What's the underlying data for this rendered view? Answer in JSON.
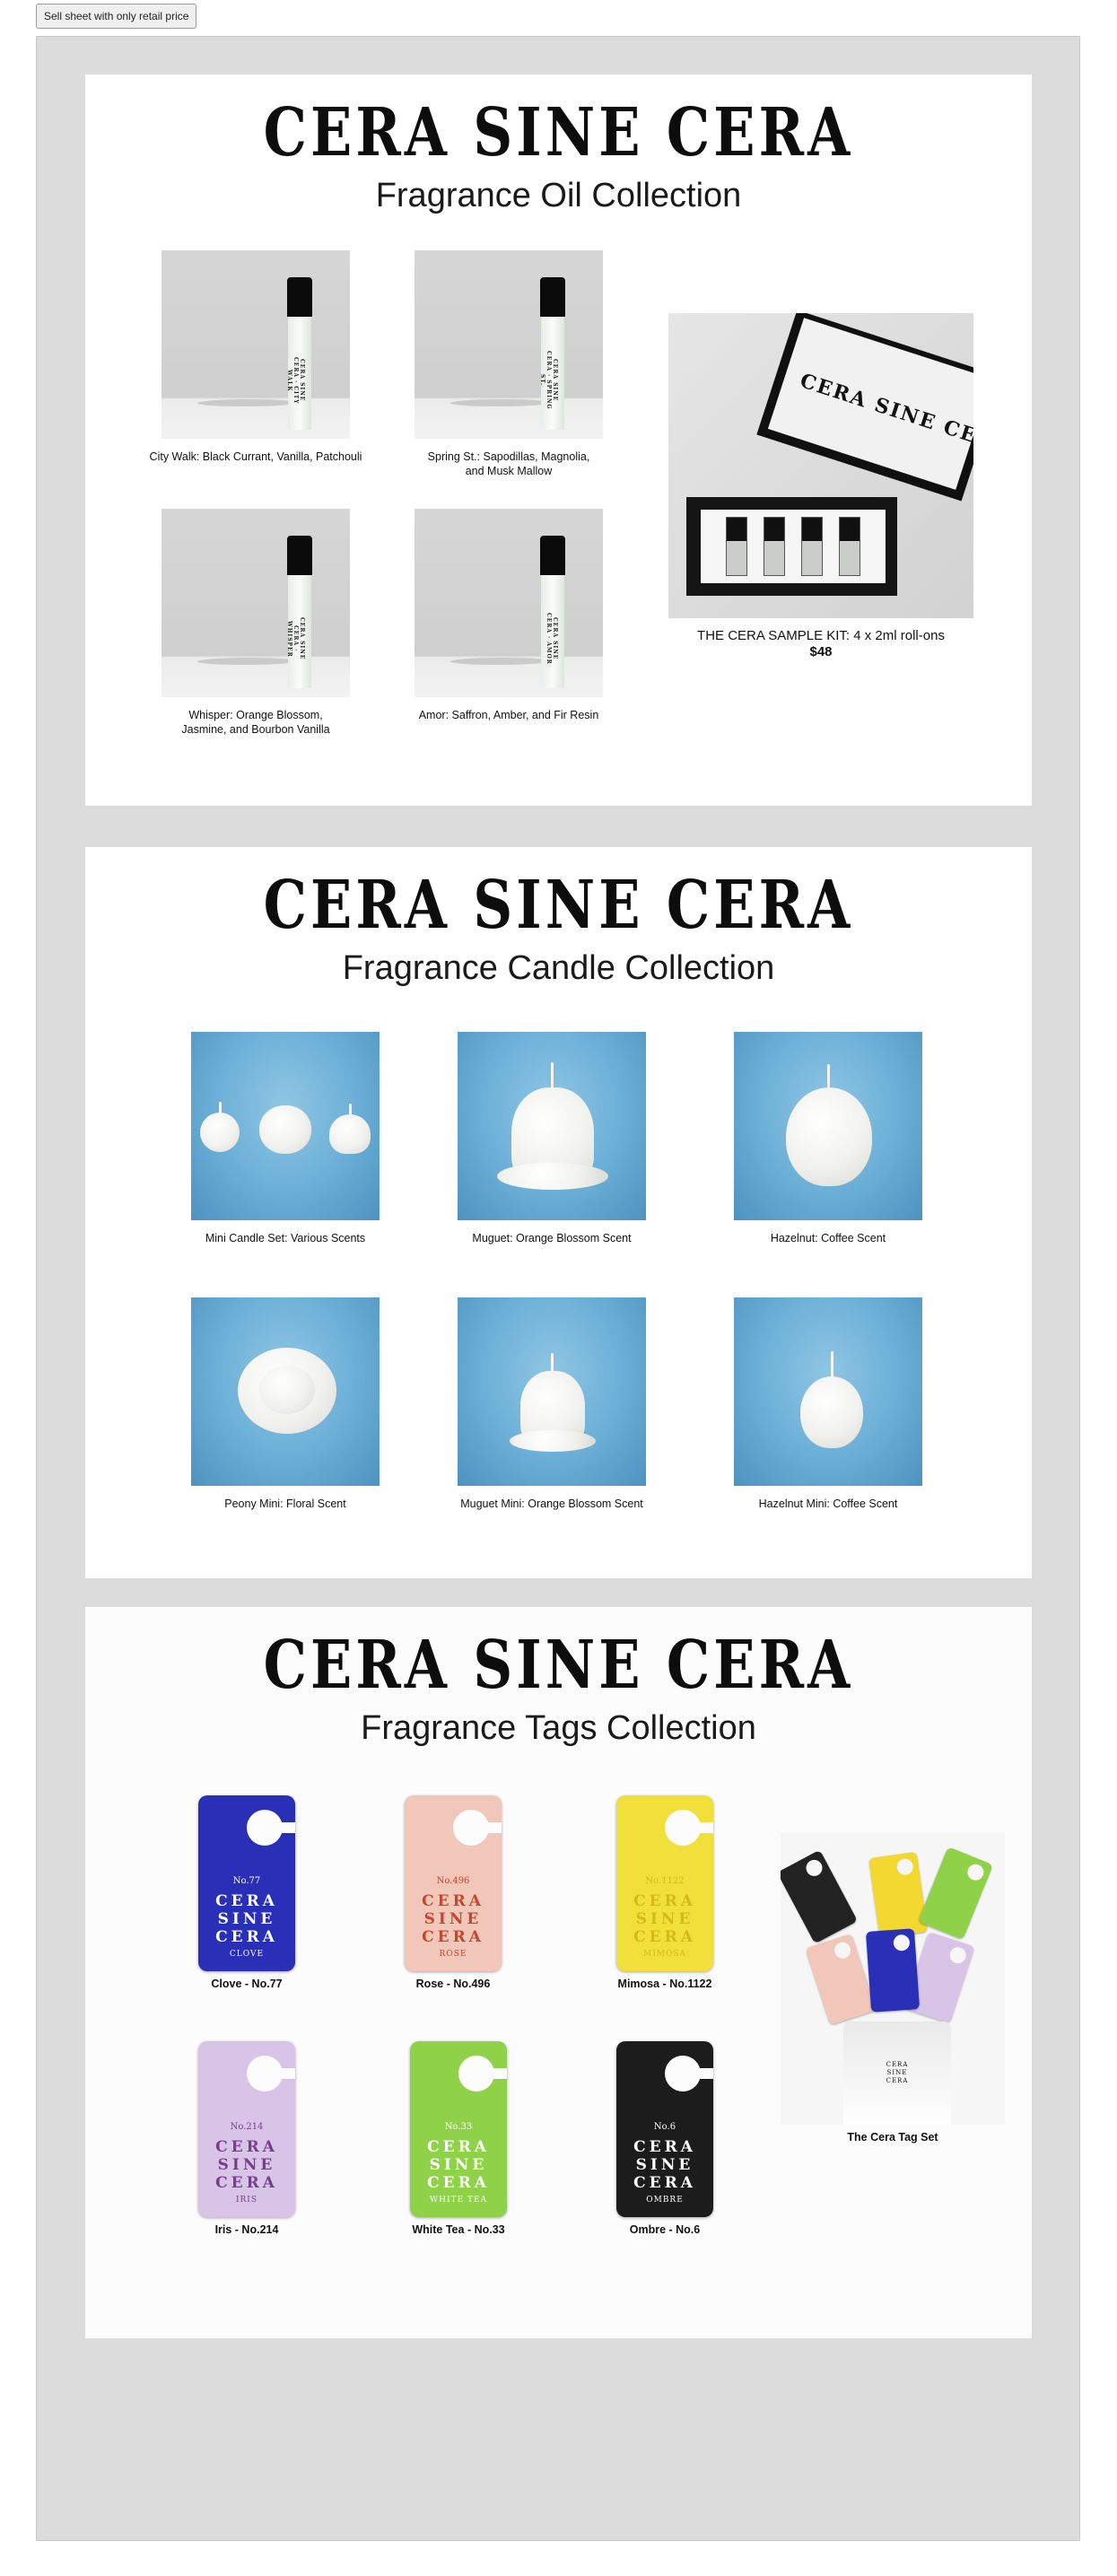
{
  "toolbar": {
    "sell_sheet_button": "Sell sheet with only retail price"
  },
  "brand": "CERA SINE CERA",
  "sections": {
    "oil": {
      "title": "Fragrance Oil Collection",
      "products": [
        {
          "caption": "City Walk: Black Currant, Vanilla, Patchouli",
          "bottle_label": "CERA SINE CERA · CITY WALK"
        },
        {
          "caption": "Spring St.: Sapodillas, Magnolia, and Musk Mallow",
          "bottle_label": "CERA SINE CERA · SPRING ST."
        },
        {
          "caption": "Whisper: Orange Blossom, Jasmine, and Bourbon Vanilla",
          "bottle_label": "CERA SINE CERA · WHISPER"
        },
        {
          "caption": "Amor: Saffron, Amber, and Fir Resin",
          "bottle_label": "CERA SINE CERA · AMOR"
        }
      ],
      "kit": {
        "caption": "THE CERA SAMPLE KIT: 4 x 2ml roll-ons",
        "price": "$48",
        "box_label": "CERA SINE CERA"
      }
    },
    "candle": {
      "title": "Fragrance Candle Collection",
      "products": [
        {
          "caption": "Mini Candle Set: Various Scents"
        },
        {
          "caption": "Muguet: Orange Blossom Scent"
        },
        {
          "caption": "Hazelnut: Coffee Scent"
        },
        {
          "caption": "Peony Mini: Floral Scent"
        },
        {
          "caption": "Muguet Mini: Orange Blossom Scent"
        },
        {
          "caption": "Hazelnut Mini: Coffee Scent"
        }
      ]
    },
    "tags": {
      "title": "Fragrance Tags Collection",
      "products": [
        {
          "caption": "Clove - No.77",
          "num": "No.77",
          "name": "CERA SINE CERA",
          "scent": "CLOVE",
          "color": "#2a2fb8",
          "ink": "#ffffff"
        },
        {
          "caption": "Rose - No.496",
          "num": "No.496",
          "name": "CERA SINE CERA",
          "scent": "ROSE",
          "color": "#f0c7b8",
          "ink": "#c8452e"
        },
        {
          "caption": "Mimosa - No.1122",
          "num": "No.1122",
          "name": "CERA SINE CERA",
          "scent": "MIMOSA",
          "color": "#f2e03a",
          "ink": "#e0c020"
        },
        {
          "caption": "Iris - No.214",
          "num": "No.214",
          "name": "CERA SINE CERA",
          "scent": "IRIS",
          "color": "#d8c4e6",
          "ink": "#7a3d8e"
        },
        {
          "caption": "White Tea - No.33",
          "num": "No.33",
          "name": "CERA SINE CERA",
          "scent": "WHITE TEA",
          "color": "#8fd24a",
          "ink": "#ffffff"
        },
        {
          "caption": "Ombre - No.6",
          "num": "No.6",
          "name": "CERA SINE CERA",
          "scent": "OMBRE",
          "color": "#1c1c1c",
          "ink": "#ffffff"
        }
      ],
      "set": {
        "caption": "The Cera Tag Set",
        "pouch_label": "CERA SINE CERA"
      }
    }
  }
}
